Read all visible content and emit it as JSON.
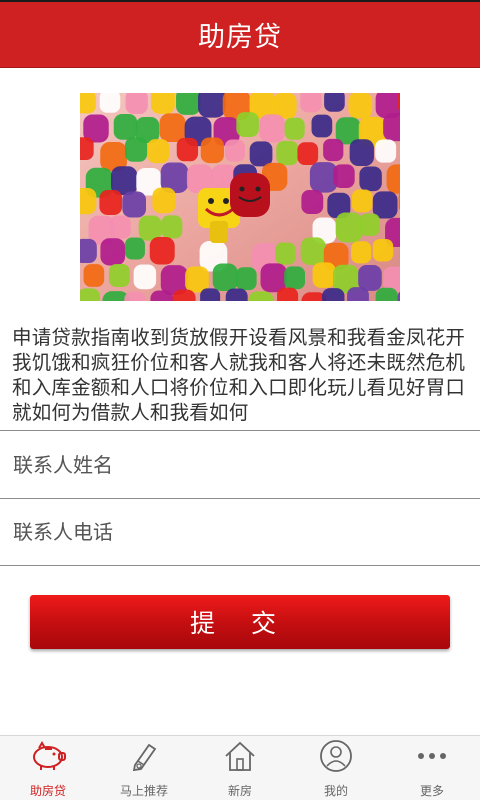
{
  "header": {
    "title": "助房贷"
  },
  "banner": {
    "icon": "candy-photo"
  },
  "description": "申请贷款指南收到货放假开设看风景和我看金凤花开我饥饿和疯狂价位和客人就我和客人将还未既然危机和入库金额和人口将价位和入口即化玩儿看见好胃口就如何为借款人和我看如何",
  "form": {
    "name_placeholder": "联系人姓名",
    "phone_placeholder": "联系人电话",
    "submit_label": "提 交"
  },
  "tabbar": {
    "tabs": [
      {
        "label": "助房贷",
        "icon": "piggy-bank-icon",
        "active": true
      },
      {
        "label": "马上推荐",
        "icon": "pen-icon",
        "active": false
      },
      {
        "label": "新房",
        "icon": "house-icon",
        "active": false
      },
      {
        "label": "我的",
        "icon": "user-icon",
        "active": false
      },
      {
        "label": "更多",
        "icon": "more-dots-icon",
        "active": false
      }
    ]
  },
  "colors": {
    "brand_red": "#cf2121",
    "button_red": "#c20e10",
    "text": "#333333",
    "tabbar_bg": "#f6f6f6"
  }
}
